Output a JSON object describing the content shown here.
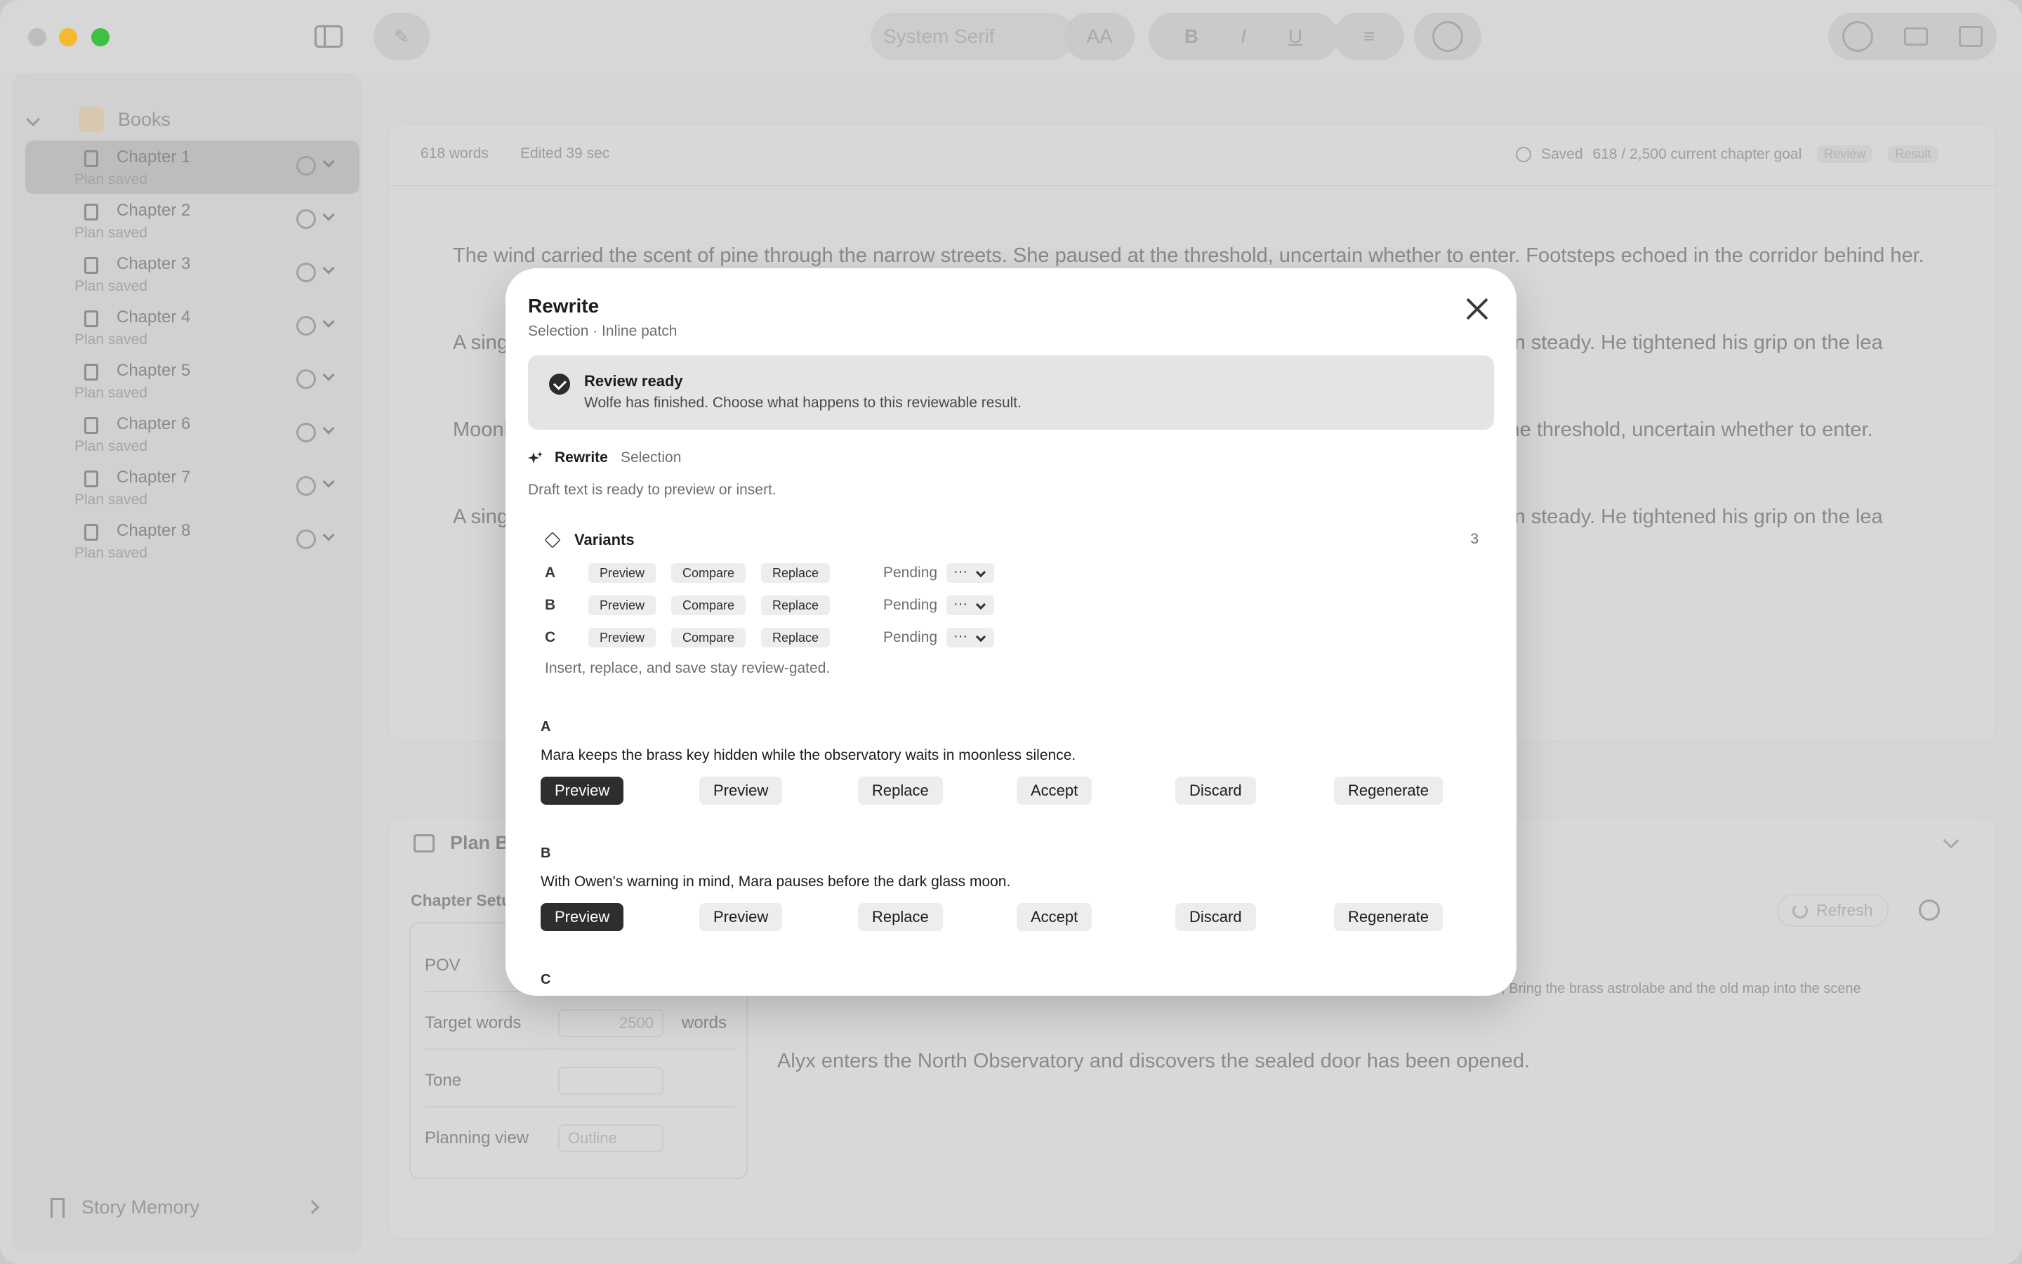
{
  "toolbar": {
    "font_placeholder": "System Serif",
    "font_size_label": "AA",
    "bold": "B",
    "italic": "I",
    "underline": "U"
  },
  "sidebar": {
    "section_title": "Books",
    "chapters": [
      {
        "title": "Chapter 1",
        "status": "Plan saved"
      },
      {
        "title": "Chapter 2",
        "status": "Plan saved"
      },
      {
        "title": "Chapter 3",
        "status": "Plan saved"
      },
      {
        "title": "Chapter 4",
        "status": "Plan saved"
      },
      {
        "title": "Chapter 5",
        "status": "Plan saved"
      },
      {
        "title": "Chapter 6",
        "status": "Plan saved"
      },
      {
        "title": "Chapter 7",
        "status": "Plan saved"
      },
      {
        "title": "Chapter 8",
        "status": "Plan saved"
      }
    ],
    "story_memory": "Story Memory"
  },
  "editor": {
    "word_count": "618 words",
    "edited": "Edited  39 sec",
    "saved": "Saved",
    "goal": "618 / 2,500 current chapter goal",
    "review_chip": "Review",
    "result_chip": "Result",
    "paragraphs": [
      "The wind carried the scent of pine through the narrow streets. She paused at the threshold, uncertain whether to enter. Footsteps echoed in the corridor behind her.",
      "A sing                                                                                                                                                                   t first, then steady. He tightened his grip on the lea",
      "Moonl                                                                                                                                                                   used at the threshold, uncertain whether to enter.",
      "A sing                                                                                                                                                                   t first, then steady. He tightened his grip on the lea"
    ]
  },
  "plan": {
    "title": "Plan Bo",
    "setup_title": "Chapter Setu",
    "pov_label": "POV",
    "target_label": "Target words",
    "target_value": "2500",
    "target_unit": "words",
    "tone_label": "Tone",
    "view_label": "Planning view",
    "view_value": "Outline",
    "refresh": "Refresh",
    "objectives": "and discovers the sealed door has been opened; Establish (pov)'s immediate objective and the unanswered danger; Bring the brass astrolabe and the old map into the scene",
    "summary": "Alyx enters the North Observatory and discovers the sealed door has been opened."
  },
  "modal": {
    "title": "Rewrite",
    "subtitle": "Selection · Inline patch",
    "banner_title": "Review ready",
    "banner_desc": "Wolfe has finished. Choose what happens to this reviewable result.",
    "mode_label": "Rewrite",
    "mode_scope": "Selection",
    "draft_note": "Draft text is ready to preview or insert.",
    "variants_title": "Variants",
    "variants_count": "3",
    "variants": [
      {
        "letter": "A",
        "preview": "Preview",
        "compare": "Compare",
        "replace": "Replace",
        "status": "Pending",
        "menu": "···"
      },
      {
        "letter": "B",
        "preview": "Preview",
        "compare": "Compare",
        "replace": "Replace",
        "status": "Pending",
        "menu": "···"
      },
      {
        "letter": "C",
        "preview": "Preview",
        "compare": "Compare",
        "replace": "Replace",
        "status": "Pending",
        "menu": "···"
      }
    ],
    "gate_note": "Insert, replace, and save stay review-gated.",
    "results": [
      {
        "letter": "A",
        "text": "Mara keeps the brass key hidden while the observatory waits in moonless silence.",
        "b1": "Preview",
        "b2": "Preview",
        "b3": "Replace",
        "b4": "Accept",
        "b5": "Discard",
        "b6": "Regenerate"
      },
      {
        "letter": "B",
        "text": "With Owen's warning in mind, Mara pauses before the dark glass moon.",
        "b1": "Preview",
        "b2": "Preview",
        "b3": "Replace",
        "b4": "Accept",
        "b5": "Discard",
        "b6": "Regenerate"
      },
      {
        "letter": "C"
      }
    ]
  },
  "colors": {
    "accent_dark": "#2e2e2e",
    "traffic_min": "#f5b92e",
    "traffic_max": "#3cc143"
  }
}
